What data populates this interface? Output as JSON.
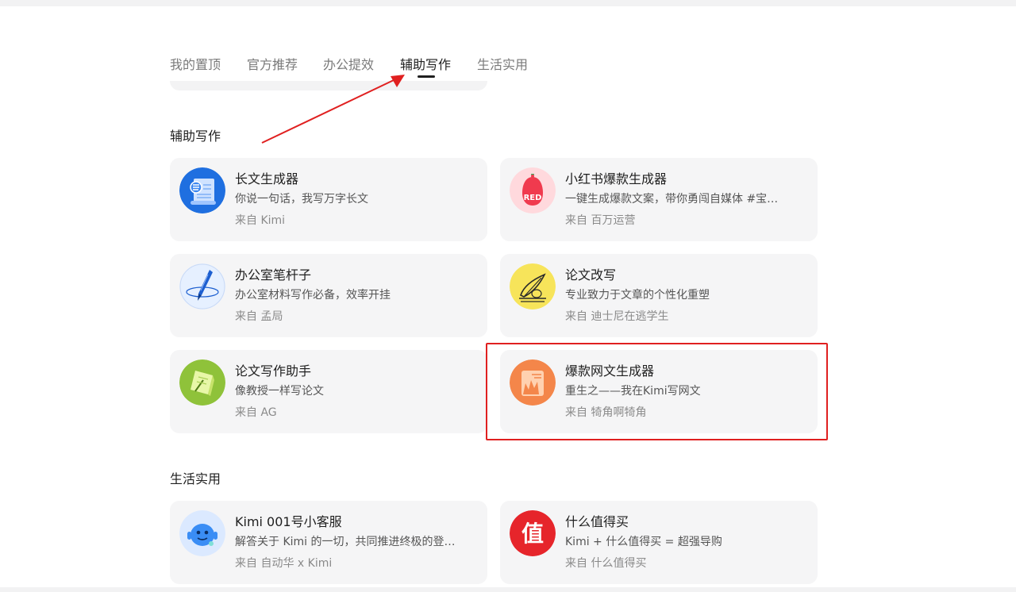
{
  "tabs": [
    {
      "label": "我的置顶"
    },
    {
      "label": "官方推荐"
    },
    {
      "label": "办公提效"
    },
    {
      "label": "辅助写作"
    },
    {
      "label": "生活实用"
    }
  ],
  "active_tab": "辅助写作",
  "sections": [
    {
      "title": "辅助写作",
      "cards": [
        {
          "name": "长文生成器",
          "desc": "你说一句话，我写万字长文",
          "from": "来自 Kimi",
          "icon": "document-scroll-icon"
        },
        {
          "name": "小红书爆款生成器",
          "desc": "一键生成爆款文案，带你勇闯自媒体 #宝…",
          "from": "来自 百万运营",
          "icon": "red-bag-icon",
          "icon_text": "RED"
        },
        {
          "name": "办公室笔杆子",
          "desc": "办公室材料写作必备，效率开挂",
          "from": "来自 孟局",
          "icon": "fountain-pen-icon"
        },
        {
          "name": "论文改写",
          "desc": "专业致力于文章的个性化重塑",
          "from": "来自 迪士尼在逃学生",
          "icon": "quill-ink-icon"
        },
        {
          "name": "论文写作助手",
          "desc": "像教授一样写论文",
          "from": "来自 AG",
          "icon": "paper-note-icon"
        },
        {
          "name": "爆款网文生成器",
          "desc": "重生之——我在Kimi写网文",
          "from": "来自 犄角啊犄角",
          "icon": "fire-novel-icon"
        }
      ]
    },
    {
      "title": "生活实用",
      "cards": [
        {
          "name": "Kimi 001号小客服",
          "desc": "解答关于 Kimi 的一切，共同推进终极的登…",
          "from": "来自 自动华 x Kimi",
          "icon": "robot-support-icon"
        },
        {
          "name": "什么值得买",
          "desc": "Kimi + 什么值得买 = 超强导购",
          "from": "来自 什么值得买",
          "icon": "zhi-logo-icon",
          "icon_text": "值"
        }
      ]
    }
  ],
  "colors": {
    "highlight": "#e02020",
    "card_bg": "#f5f5f6",
    "active_tab": "#1f1f1f",
    "inactive_tab": "#7a7a7a"
  }
}
